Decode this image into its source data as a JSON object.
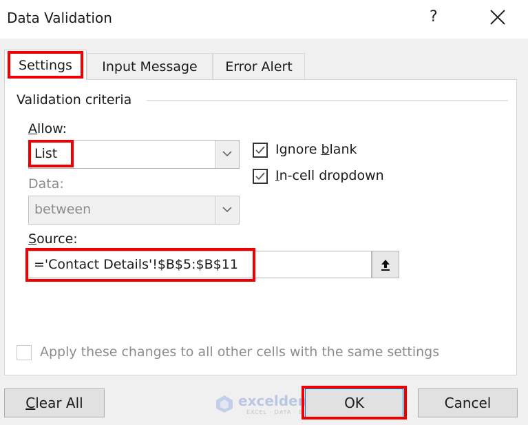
{
  "window": {
    "title": "Data Validation",
    "help_label": "?",
    "close_icon": "close-icon"
  },
  "tabs": [
    {
      "label": "Settings",
      "active": true
    },
    {
      "label": "Input Message",
      "active": false
    },
    {
      "label": "Error Alert",
      "active": false
    }
  ],
  "settings": {
    "group_label": "Validation criteria",
    "allow": {
      "label_accel": "A",
      "label_rest": "llow:",
      "value": "List"
    },
    "data": {
      "label": "Data:",
      "value": "between",
      "disabled": true
    },
    "ignore_blank": {
      "label_pre": "Ignore ",
      "label_accel": "b",
      "label_post": "lank",
      "checked": true
    },
    "in_cell_dropdown": {
      "label_accel": "I",
      "label_rest": "n-cell dropdown",
      "checked": true
    },
    "source": {
      "label_accel": "S",
      "label_rest": "ource:",
      "value": "='Contact Details'!$B$5:$B$11",
      "collapse_icon": "collapse-dialog-icon"
    },
    "apply_all": {
      "label": "Apply these changes to all other cells with the same settings",
      "checked": false,
      "disabled": true
    }
  },
  "buttons": {
    "clear_all_accel": "C",
    "clear_all_rest": "lear All",
    "ok": "OK",
    "cancel": "Cancel"
  },
  "watermark": {
    "name": "exceldemy",
    "tagline": "EXCEL · DATA · BI"
  },
  "colors": {
    "highlight": "#ee0000",
    "focus": "#0078d7"
  }
}
